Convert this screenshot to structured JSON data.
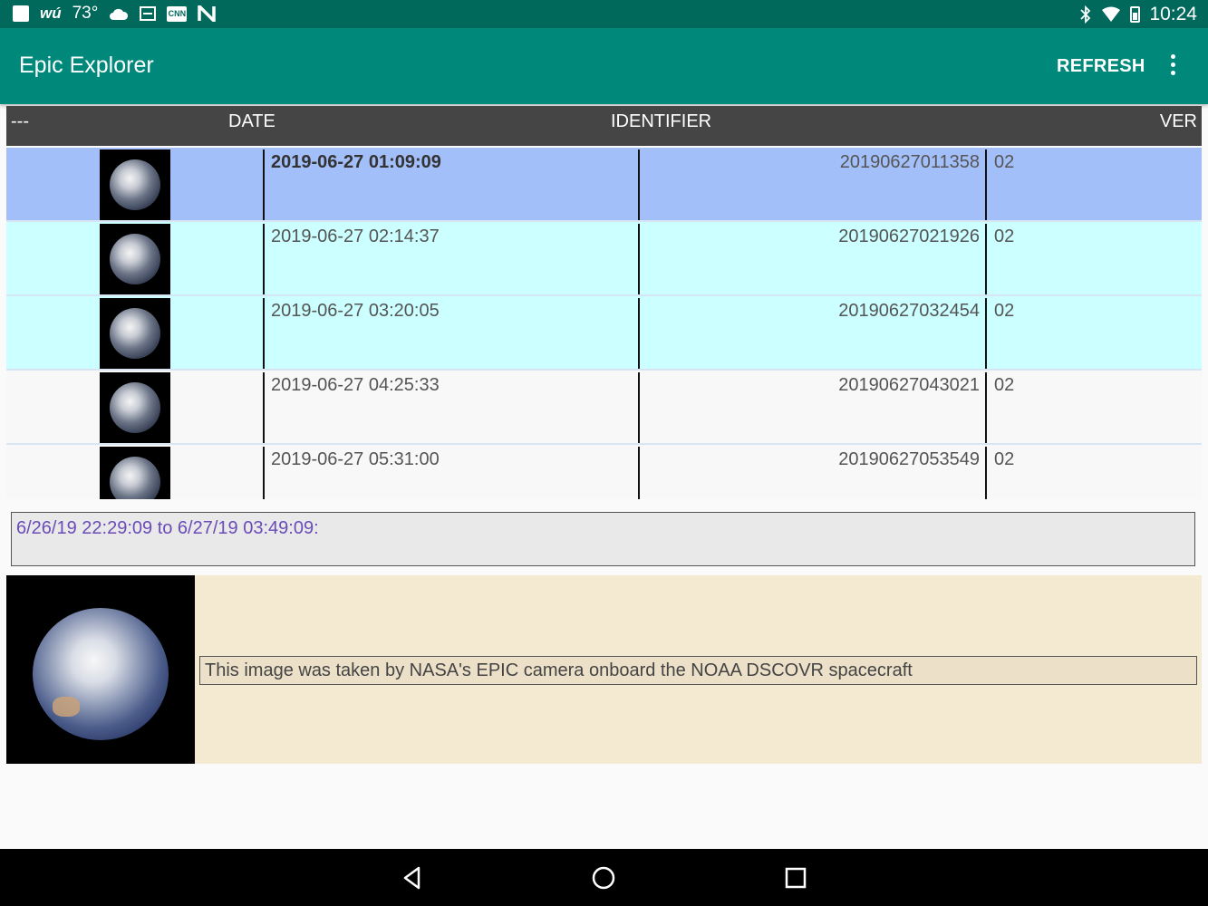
{
  "status_bar": {
    "weather_brand": "wú",
    "temperature": "73°",
    "cnn_label": "CNN",
    "time": "10:24",
    "icons": [
      "square-icon",
      "cloud-icon",
      "calendar-icon",
      "cnn-icon",
      "n-icon",
      "bluetooth-icon",
      "wifi-icon",
      "battery-icon"
    ]
  },
  "app_bar": {
    "title": "Epic Explorer",
    "refresh_label": "REFRESH",
    "overflow_icon": "more-vert-icon"
  },
  "table": {
    "headers": {
      "thumb": "---",
      "date": "DATE",
      "identifier": "IDENTIFIER",
      "version": "VER"
    },
    "rows": [
      {
        "date": "2019-06-27 01:09:09",
        "identifier": "20190627011358",
        "version": "02",
        "state": "selected"
      },
      {
        "date": "2019-06-27 02:14:37",
        "identifier": "20190627021926",
        "version": "02",
        "state": "highlighted"
      },
      {
        "date": "2019-06-27 03:20:05",
        "identifier": "20190627032454",
        "version": "02",
        "state": "highlighted"
      },
      {
        "date": "2019-06-27 04:25:33",
        "identifier": "20190627043021",
        "version": "02",
        "state": "normal"
      },
      {
        "date": "2019-06-27 05:31:00",
        "identifier": "20190627053549",
        "version": "02",
        "state": "normal"
      }
    ]
  },
  "range_text": "6/26/19 22:29:09 to 6/27/19 03:49:09:",
  "detail": {
    "caption": "This image was taken by NASA's EPIC camera onboard the NOAA DSCOVR spacecraft"
  },
  "colors": {
    "status_bar": "#00695c",
    "app_bar": "#00897b",
    "header": "#454545",
    "row_selected": "#a3bffa",
    "row_highlight": "#ccffff",
    "range_text": "#6a4bb8",
    "detail_bg": "#f4ead2"
  }
}
